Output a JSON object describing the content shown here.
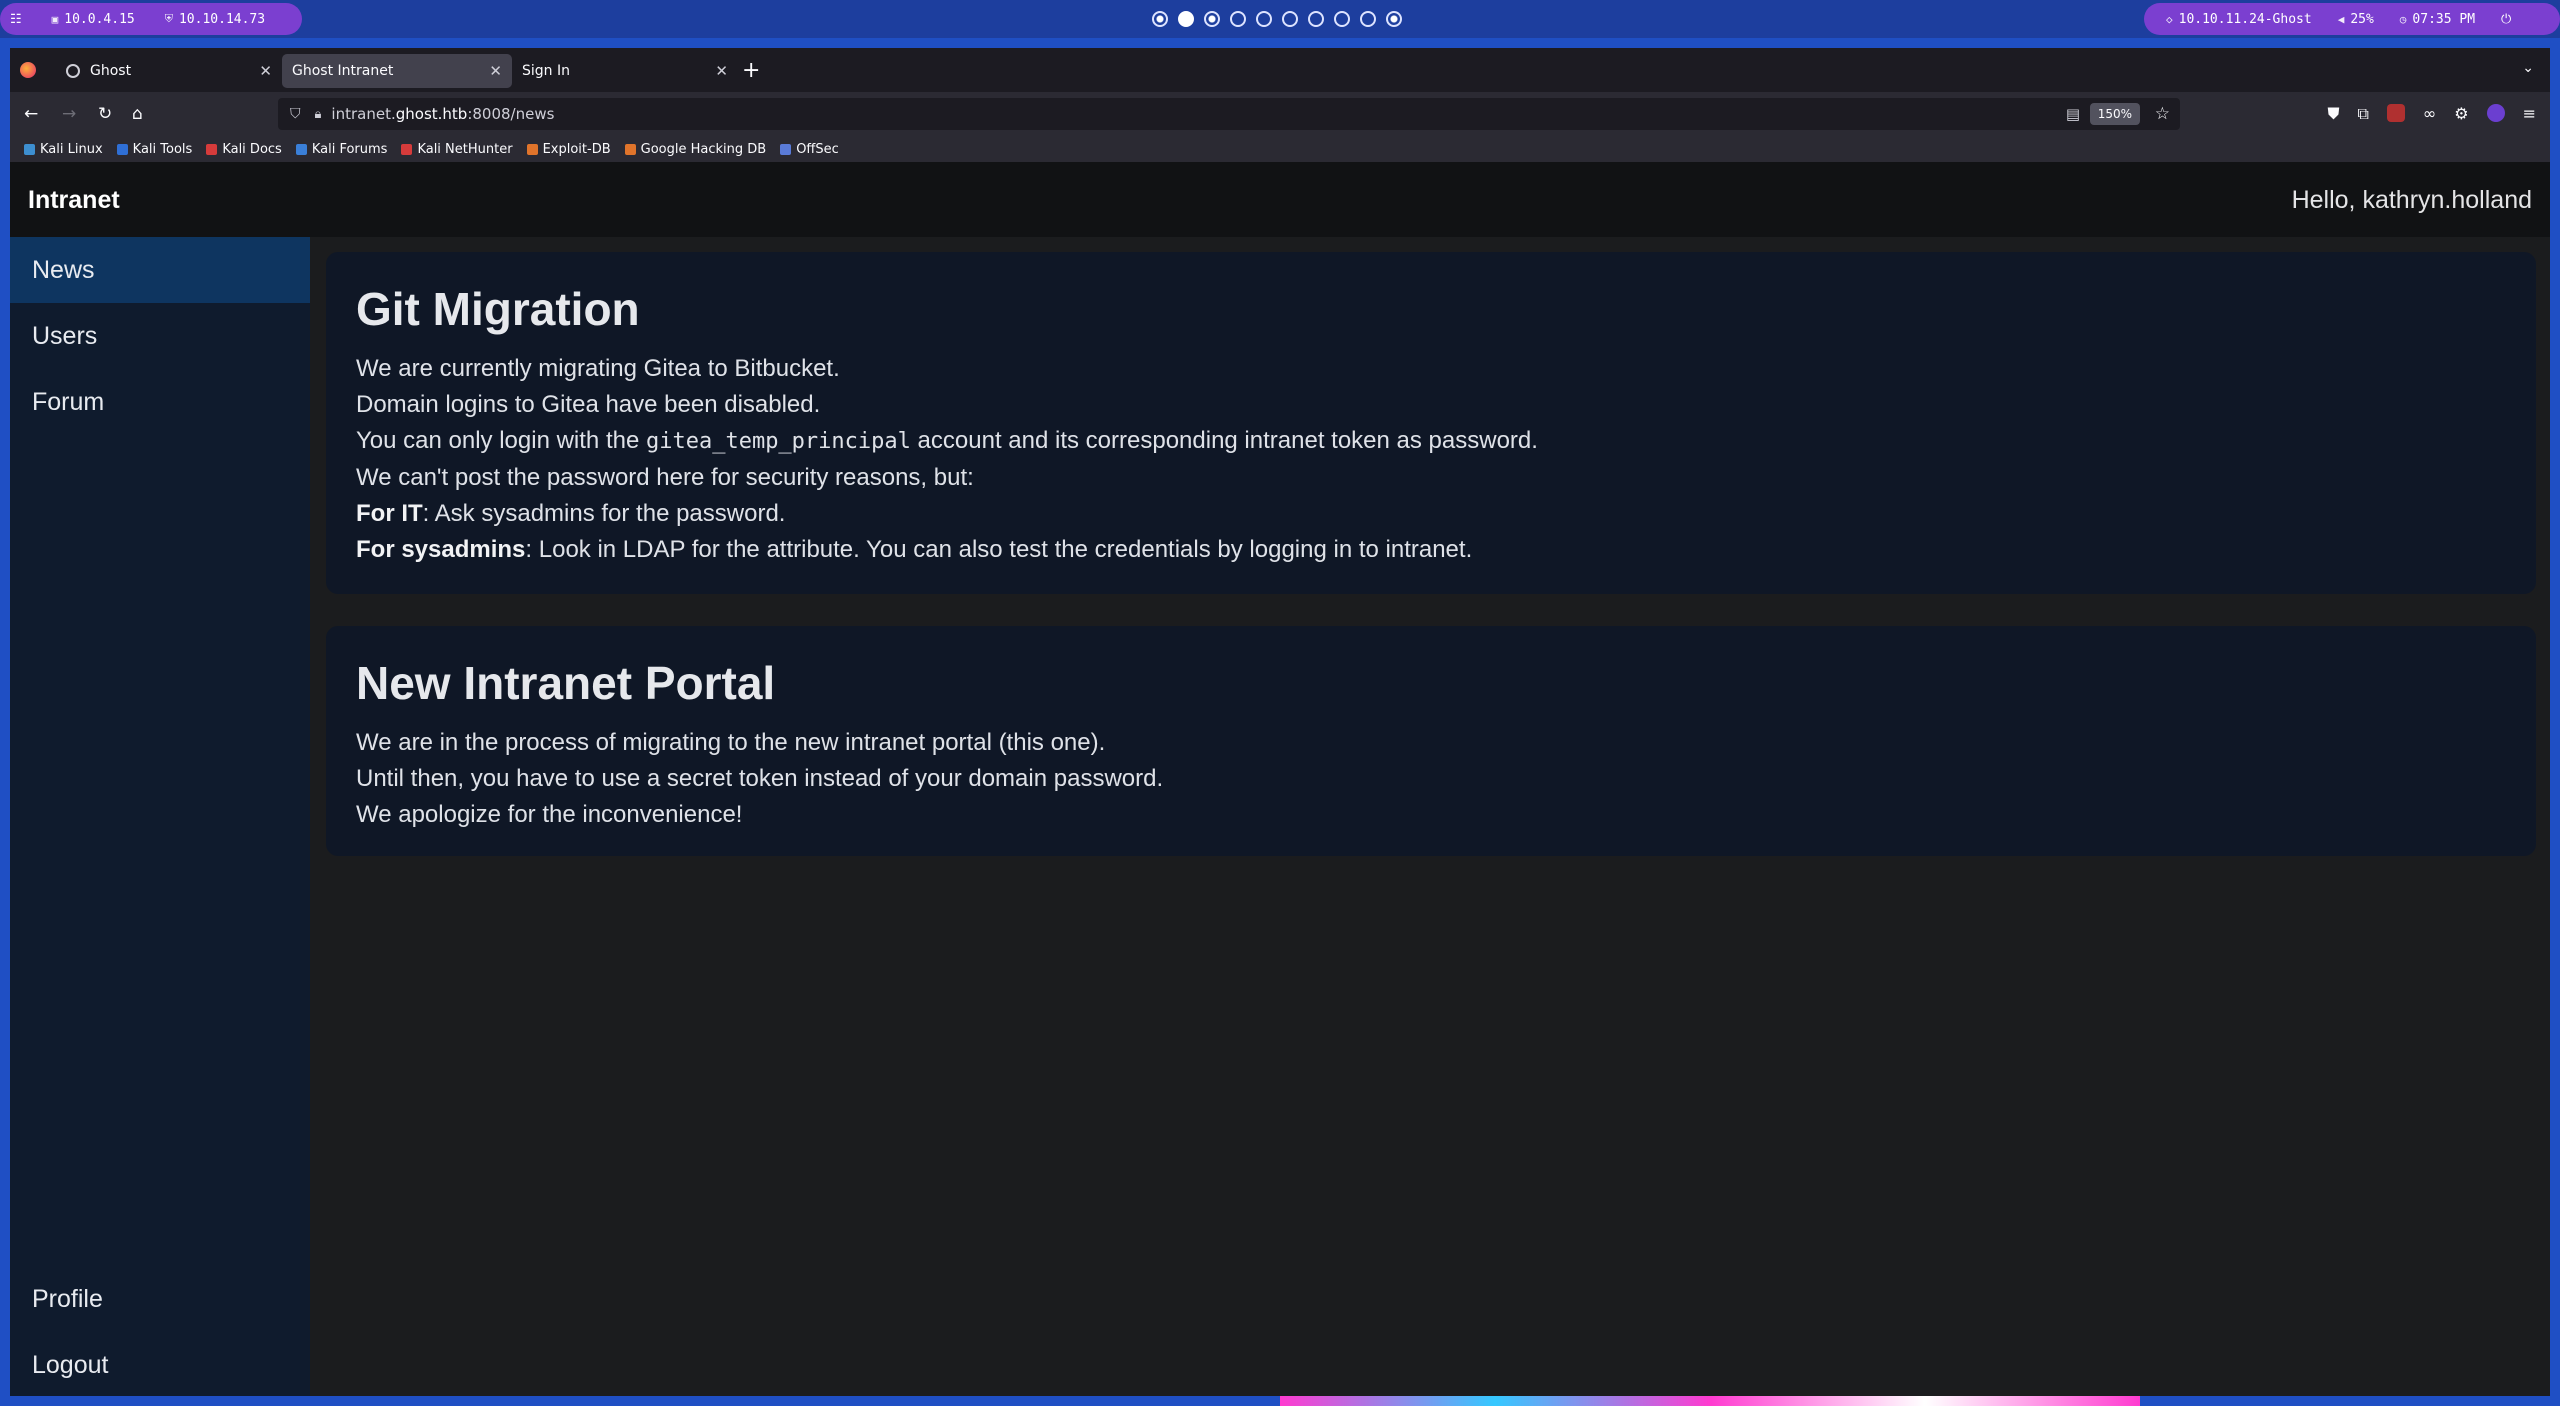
{
  "desktop": {
    "left_pill": [
      {
        "icon": "menu-icon",
        "label": ""
      },
      {
        "icon": "monitor-icon",
        "label": "10.0.4.15"
      },
      {
        "icon": "vpn-shield-icon",
        "label": "10.10.14.73"
      }
    ],
    "workspace_count": 10,
    "active_workspace": 1,
    "right_pill": {
      "target": "10.10.11.24-Ghost",
      "volume": "25%",
      "time": "07:35 PM"
    }
  },
  "browser": {
    "tabs": [
      {
        "label": "Ghost",
        "active": false
      },
      {
        "label": "Ghost Intranet",
        "active": true
      },
      {
        "label": "Sign In",
        "active": false
      }
    ],
    "url": {
      "prefix": "intranet.",
      "host": "ghost.htb",
      "rest": ":8008/news"
    },
    "zoom": "150%",
    "bookmarks": [
      {
        "label": "Kali Linux",
        "color": "#3d8fd1"
      },
      {
        "label": "Kali Tools",
        "color": "#2f6fd6"
      },
      {
        "label": "Kali Docs",
        "color": "#d63b3b"
      },
      {
        "label": "Kali Forums",
        "color": "#3a7fd8"
      },
      {
        "label": "Kali NetHunter",
        "color": "#d63b3b"
      },
      {
        "label": "Exploit-DB",
        "color": "#e0742b"
      },
      {
        "label": "Google Hacking DB",
        "color": "#e0742b"
      },
      {
        "label": "OffSec",
        "color": "#5a7bd8"
      }
    ]
  },
  "app": {
    "brand": "Intranet",
    "greeting": "Hello, kathryn.holland",
    "nav": {
      "top": [
        "News",
        "Users",
        "Forum"
      ],
      "bottom": [
        "Profile",
        "Logout"
      ],
      "active": "News"
    },
    "posts": [
      {
        "title": "Git Migration",
        "lines": [
          "We are currently migrating Gitea to Bitbucket.",
          "Domain logins to Gitea have been disabled."
        ],
        "code_line": {
          "before": "You can only login with the ",
          "code": "gitea_temp_principal",
          "after": " account and its corresponding intranet token as password."
        },
        "line_after_code": "We can't post the password here for security reasons, but:",
        "bold_lines": [
          {
            "bold": "For IT",
            "text": ": Ask sysadmins for the password."
          },
          {
            "bold": "For sysadmins",
            "text": ": Look in LDAP for the attribute. You can also test the credentials by logging in to intranet."
          }
        ]
      },
      {
        "title": "New Intranet Portal",
        "lines": [
          "We are in the process of migrating to the new intranet portal (this one).",
          "Until then, you have to use a secret token instead of your domain password.",
          "We apologize for the inconvenience!"
        ]
      }
    ]
  }
}
